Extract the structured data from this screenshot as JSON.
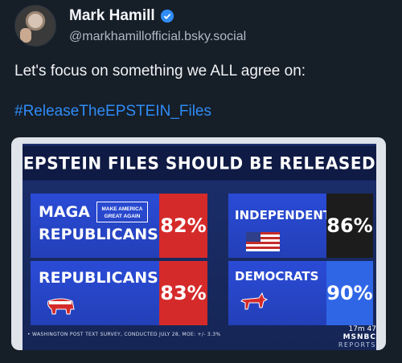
{
  "author": {
    "display_name": "Mark Hamill",
    "handle": "@markhamillofficial.bsky.social"
  },
  "post": {
    "text": "Let's focus on something we ALL agree on:",
    "hashtag": "#ReleaseTheEPSTEIN_Files"
  },
  "media": {
    "title": "EPSTEIN FILES SHOULD BE RELEASED",
    "panels": {
      "maga": {
        "label_1": "MAGA",
        "label_2": "REPUBLICANS",
        "badge": "MAKE AMERICA GREAT AGAIN",
        "value": "82%"
      },
      "independents": {
        "label": "INDEPENDENTS",
        "value": "86%"
      },
      "republicans": {
        "label": "REPUBLICANS",
        "value": "83%"
      },
      "democrats": {
        "label": "DEMOCRATS",
        "value": "90%"
      }
    },
    "source_note": "• WASHINGTON POST TEXT SURVEY, CONDUCTED JULY 28, MOE: +/- 3.3%",
    "logo": {
      "timer": "17m 47",
      "brand": "MSNBC",
      "sub": "REPORTS"
    },
    "colors": {
      "red": "#d52a2a",
      "blue": "#2a4bd6",
      "dark": "#1c1c1c"
    }
  },
  "icons": [
    "avatar",
    "verified-icon",
    "flag-icon",
    "elephant-icon",
    "donkey-icon"
  ]
}
